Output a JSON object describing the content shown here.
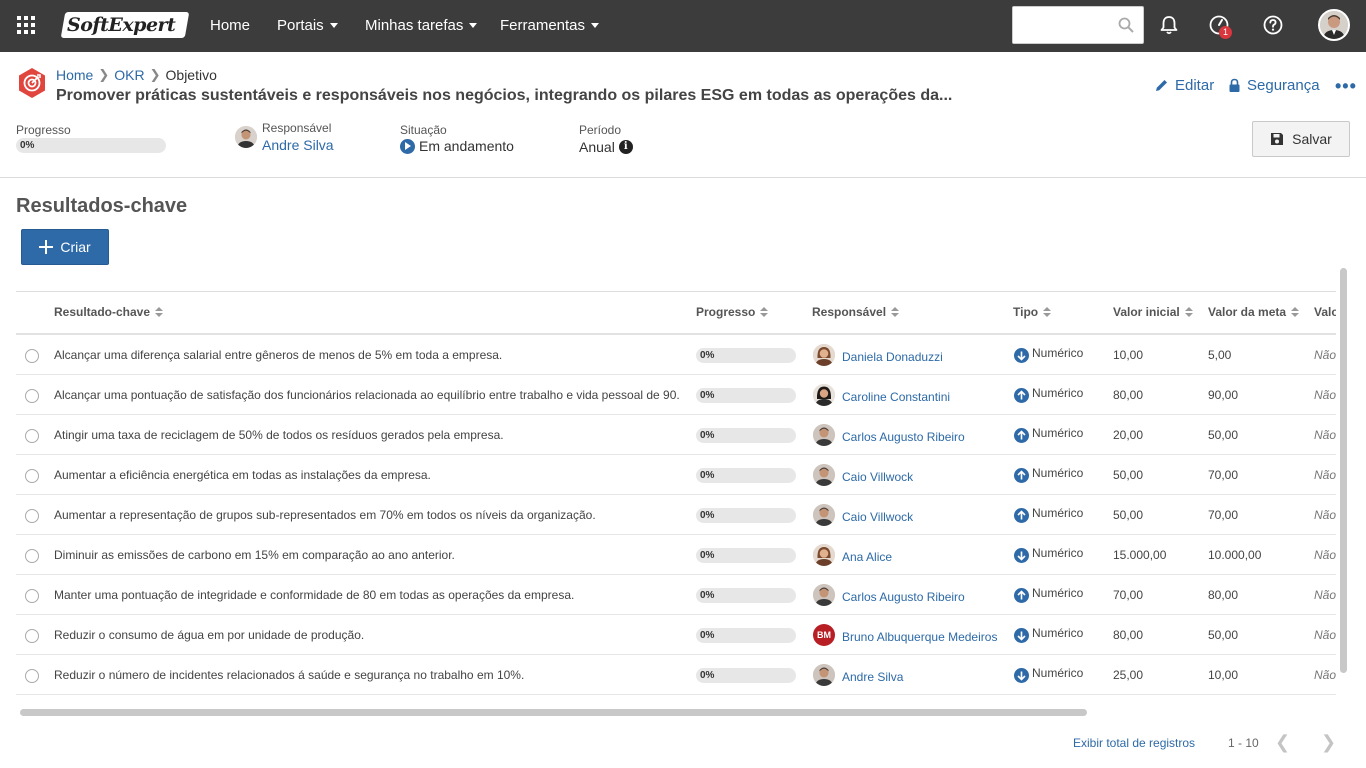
{
  "topbar": {
    "logo": "SoftExpert",
    "nav": [
      {
        "label": "Home",
        "dropdown": false
      },
      {
        "label": "Portais",
        "dropdown": true
      },
      {
        "label": "Minhas tarefas",
        "dropdown": true
      },
      {
        "label": "Ferramentas",
        "dropdown": true
      }
    ],
    "search_placeholder": "",
    "notification_badge": "1"
  },
  "header": {
    "breadcrumb": [
      "Home",
      "OKR",
      "Objetivo"
    ],
    "title": "Promover práticas sustentáveis e responsáveis nos negócios, integrando os pilares ESG em todas as operações da...",
    "edit_label": "Editar",
    "security_label": "Segurança",
    "more_label": "•••"
  },
  "meta": {
    "progress_label": "Progresso",
    "progress_value": "0%",
    "responsible_label": "Responsável",
    "responsible_name": "Andre Silva",
    "situation_label": "Situação",
    "situation_value": "Em andamento",
    "period_label": "Período",
    "period_value": "Anual",
    "save_label": "Salvar"
  },
  "section": {
    "title": "Resultados-chave",
    "create_label": "Criar"
  },
  "table": {
    "columns": [
      "Resultado-chave",
      "Progresso",
      "Responsável",
      "Tipo",
      "Valor inicial",
      "Valor da meta",
      "Valo"
    ],
    "rows": [
      {
        "name": "Alcançar uma diferença salarial entre gêneros de menos de 5% em toda a empresa.",
        "progress": "0%",
        "responsible": "Daniela Donaduzzi",
        "avatar": "female",
        "direction": "down",
        "type": "Numérico",
        "initial": "10,00",
        "target": "5,00",
        "extra": "Não"
      },
      {
        "name": "Alcançar uma pontuação de satisfação dos funcionários relacionada ao equilíbrio entre trabalho e vida pessoal de 90.",
        "progress": "0%",
        "responsible": "Caroline Constantini",
        "avatar": "female-dark",
        "direction": "up",
        "type": "Numérico",
        "initial": "80,00",
        "target": "90,00",
        "extra": "Não"
      },
      {
        "name": "Atingir uma taxa de reciclagem de 50% de todos os resíduos gerados pela empresa.",
        "progress": "0%",
        "responsible": "Carlos Augusto Ribeiro",
        "avatar": "male",
        "direction": "up",
        "type": "Numérico",
        "initial": "20,00",
        "target": "50,00",
        "extra": "Não"
      },
      {
        "name": "Aumentar a eficiência energética em todas as instalações da empresa.",
        "progress": "0%",
        "responsible": "Caio Villwock",
        "avatar": "male",
        "direction": "up",
        "type": "Numérico",
        "initial": "50,00",
        "target": "70,00",
        "extra": "Não"
      },
      {
        "name": "Aumentar a representação de grupos sub-representados em 70% em todos os níveis da organização.",
        "progress": "0%",
        "responsible": "Caio Villwock",
        "avatar": "male",
        "direction": "up",
        "type": "Numérico",
        "initial": "50,00",
        "target": "70,00",
        "extra": "Não"
      },
      {
        "name": "Diminuir as emissões de carbono em 15% em comparação ao ano anterior.",
        "progress": "0%",
        "responsible": "Ana Alice",
        "avatar": "female",
        "direction": "down",
        "type": "Numérico",
        "initial": "15.000,00",
        "target": "10.000,00",
        "extra": "Não"
      },
      {
        "name": "Manter uma pontuação de integridade e conformidade de 80 em todas as operações da empresa.",
        "progress": "0%",
        "responsible": "Carlos Augusto Ribeiro",
        "avatar": "male",
        "direction": "up",
        "type": "Numérico",
        "initial": "70,00",
        "target": "80,00",
        "extra": "Não"
      },
      {
        "name": "Reduzir o consumo de água em por unidade de produção.",
        "progress": "0%",
        "responsible": "Bruno Albuquerque Medeiros",
        "avatar": "initials",
        "initials": "BM",
        "direction": "down",
        "type": "Numérico",
        "initial": "80,00",
        "target": "50,00",
        "extra": "Não"
      },
      {
        "name": "Reduzir o número de incidentes relacionados á saúde e segurança no trabalho em 10%.",
        "progress": "0%",
        "responsible": "Andre Silva",
        "avatar": "male",
        "direction": "down",
        "type": "Numérico",
        "initial": "25,00",
        "target": "10,00",
        "extra": "Não"
      }
    ]
  },
  "footer": {
    "show_total_label": "Exibir total de registros",
    "range": "1 - 10"
  },
  "colors": {
    "topbar": "#3c3c3c",
    "primary": "#2d6aa7",
    "objective_icon": "#e0453e"
  }
}
